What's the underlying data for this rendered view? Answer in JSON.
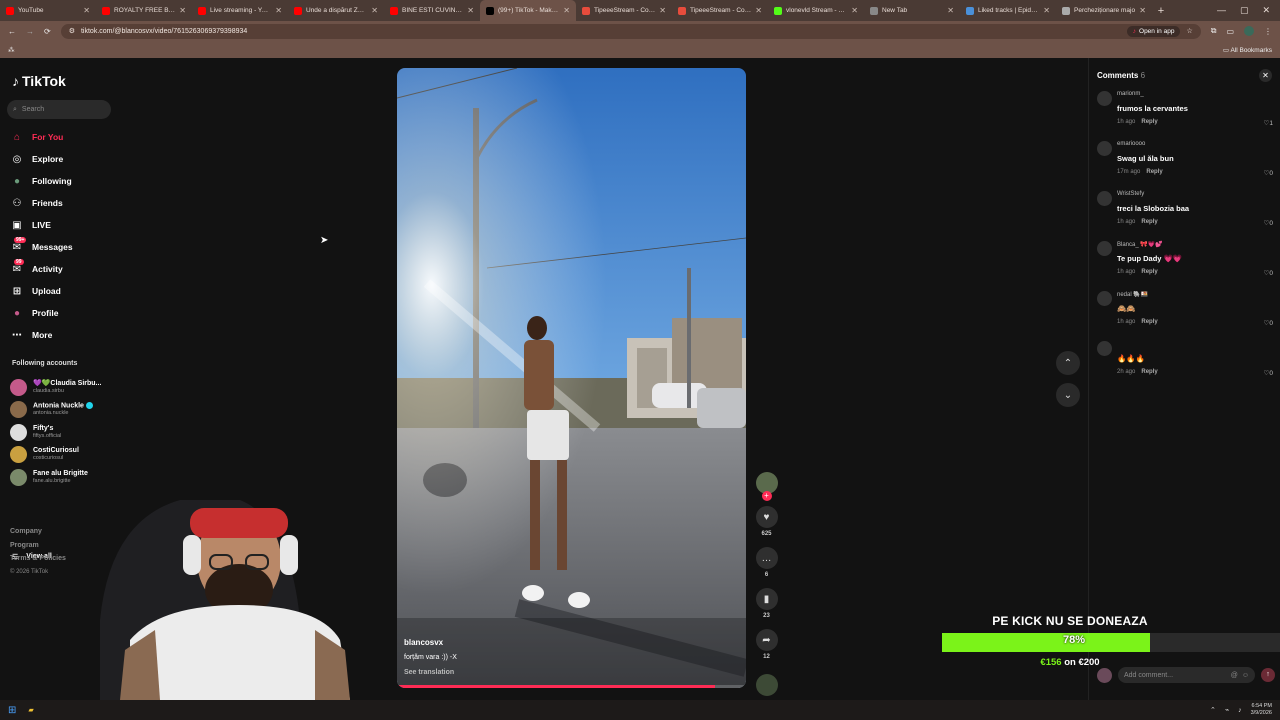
{
  "browser": {
    "tabs": [
      {
        "title": "YouTube",
        "color": "#ff0000"
      },
      {
        "title": "ROYALTY FREE Busine",
        "color": "#ff0000"
      },
      {
        "title": "Live streaming - YouTu",
        "color": "#ff0000"
      },
      {
        "title": "Unde a dispărut Zburg",
        "color": "#ff0000"
      },
      {
        "title": "BINE ESTI CUVINTAT (L",
        "color": "#ff0000"
      },
      {
        "title": "(99+) TikTok - Make Yo",
        "color": "#000000",
        "active": true
      },
      {
        "title": "TipeeeStream - Collec",
        "color": "#e74c3c"
      },
      {
        "title": "TipeeeStream - Collec",
        "color": "#e74c3c"
      },
      {
        "title": "vlonevld Stream - Wat",
        "color": "#53fc18"
      },
      {
        "title": "New Tab",
        "color": "#888888"
      },
      {
        "title": "Liked tracks | Epidem",
        "color": "#4a90d9"
      },
      {
        "title": "Percheziționare majo",
        "color": "#aaaaaa"
      }
    ],
    "url": "tiktok.com/@blancosvx/video/7615263069379398934",
    "open_in_app": "Open in app",
    "all_bookmarks": "All Bookmarks"
  },
  "sidebar": {
    "logo": "TikTok",
    "search_placeholder": "Search",
    "nav": [
      {
        "label": "For You",
        "icon": "home-icon",
        "active": true
      },
      {
        "label": "Explore",
        "icon": "compass-icon"
      },
      {
        "label": "Following",
        "icon": "following-icon"
      },
      {
        "label": "Friends",
        "icon": "friends-icon"
      },
      {
        "label": "LIVE",
        "icon": "live-icon"
      },
      {
        "label": "Messages",
        "icon": "messages-icon",
        "badge": "99+"
      },
      {
        "label": "Activity",
        "icon": "activity-icon",
        "badge": "99"
      },
      {
        "label": "Upload",
        "icon": "upload-icon"
      },
      {
        "label": "Profile",
        "icon": "profile-icon"
      },
      {
        "label": "More",
        "icon": "more-icon"
      }
    ],
    "following_title": "Following accounts",
    "following": [
      {
        "name": "💜💚Claudia Sirbu...",
        "handle": "claudia.sirbu",
        "color": "#c45a8a"
      },
      {
        "name": "Antonia Nuckle",
        "handle": "antonia.nuckle",
        "color": "#8a6a4a",
        "verified": true
      },
      {
        "name": "Fifty's",
        "handle": "fiftys.official",
        "color": "#dddddd"
      },
      {
        "name": "CostiCuriosul",
        "handle": "costicuriosul",
        "color": "#c9a040"
      },
      {
        "name": "Fane alu Brigitte",
        "handle": "fane.alu.brigitte",
        "color": "#7a8a6a"
      }
    ],
    "view_all": "View all",
    "footer": [
      "Company",
      "Program",
      "Terms & Policies"
    ],
    "copyright": "© 2026 TikTok"
  },
  "video": {
    "username": "blancosvx",
    "caption": "forțăm vara :)) -X",
    "see_translation": "See translation",
    "progress": 0.91
  },
  "actions": {
    "likes": "625",
    "comments": "6",
    "saves": "23",
    "shares": "12"
  },
  "comments": {
    "title": "Comments",
    "count": "6",
    "items": [
      {
        "user": "marionm_",
        "text": "frumos la cervantes",
        "time": "1h ago",
        "likes": "1"
      },
      {
        "user": "emarioooo",
        "text": "Swag ul ăla bun",
        "time": "17m ago",
        "likes": "0"
      },
      {
        "user": "WristStefy",
        "text": "treci la Slobozia baa",
        "time": "1h ago",
        "likes": "0"
      },
      {
        "user": "Blanca_ 🎀💗💕",
        "text": "Te pup Dady 💗💗",
        "time": "1h ago",
        "likes": "0"
      },
      {
        "user": "nedal 🐘🍱",
        "text": "🙈🙈",
        "time": "1h ago",
        "likes": "0"
      },
      {
        "user": "",
        "text": "🔥🔥🔥",
        "time": "2h ago",
        "likes": "0"
      }
    ],
    "reply_label": "Reply",
    "input_placeholder": "Add comment..."
  },
  "overlay": {
    "title": "PE KICK NU SE DONEAZA",
    "percent": 78,
    "percent_label": "78%",
    "raised": "€156",
    "on_label": "on",
    "goal": "€200",
    "bar_color": "#7bf319"
  },
  "taskbar": {
    "time": "6:54 PM",
    "date": "3/9/2026"
  }
}
